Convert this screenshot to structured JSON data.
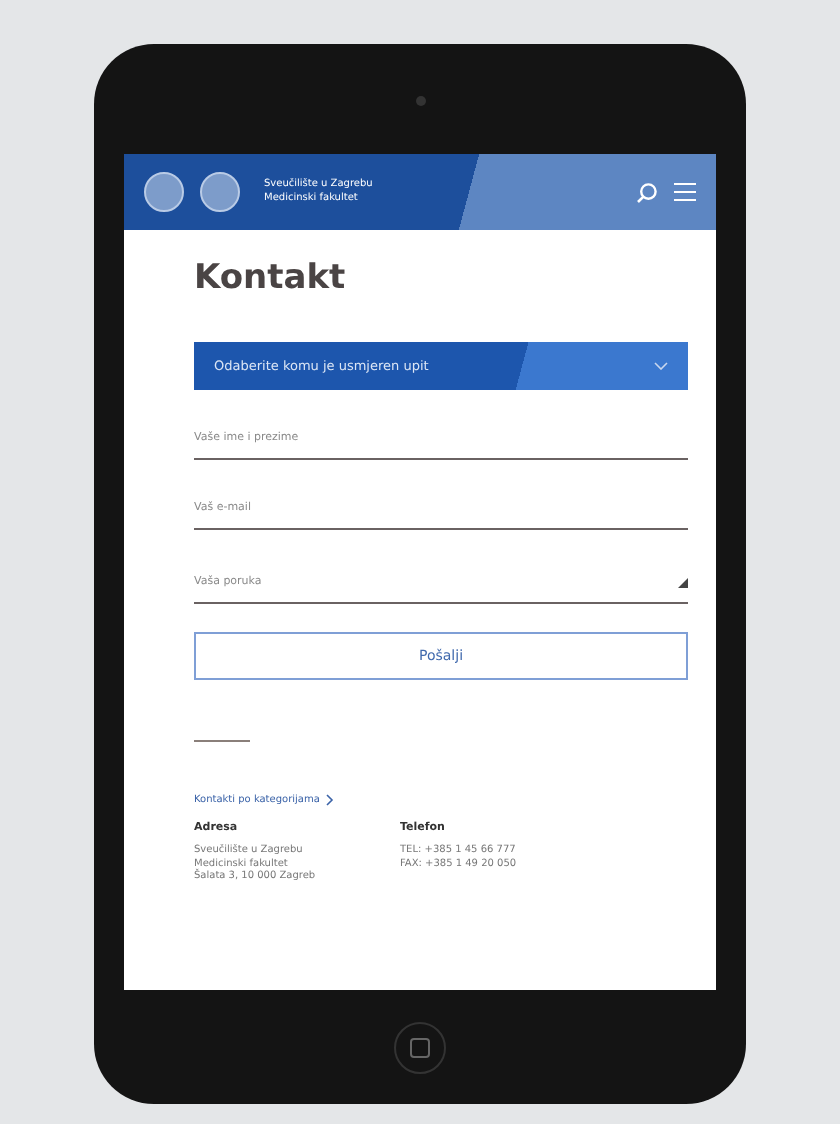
{
  "header": {
    "logo_line_1": "Sveučilište u Zagrebu",
    "logo_line_2": "Medicinski fakultet"
  },
  "page_title": "Kontakt",
  "recipient_select": {
    "placeholder": "Odaberite komu je usmjeren upit",
    "expanded": false
  },
  "fields": [
    {
      "kind": "input",
      "placeholder": "Vaše ime i prezime"
    },
    {
      "kind": "input",
      "placeholder": "Vaš e-mail"
    },
    {
      "kind": "textarea",
      "placeholder": "Vaša poruka"
    }
  ],
  "submit_button": "Pošalji",
  "category_link": "Kontakti po kategorijama",
  "contact_columns": [
    {
      "heading": "Adresa",
      "lines": [
        "Sveučilište u Zagrebu",
        "Medicinski fakultet",
        "Šalata 3, 10 000 Zagreb"
      ]
    },
    {
      "heading": "Telefon",
      "lines": [
        "TEL: +385 1 45 66 777",
        "FAX: +385 1 49 20 050"
      ]
    }
  ]
}
